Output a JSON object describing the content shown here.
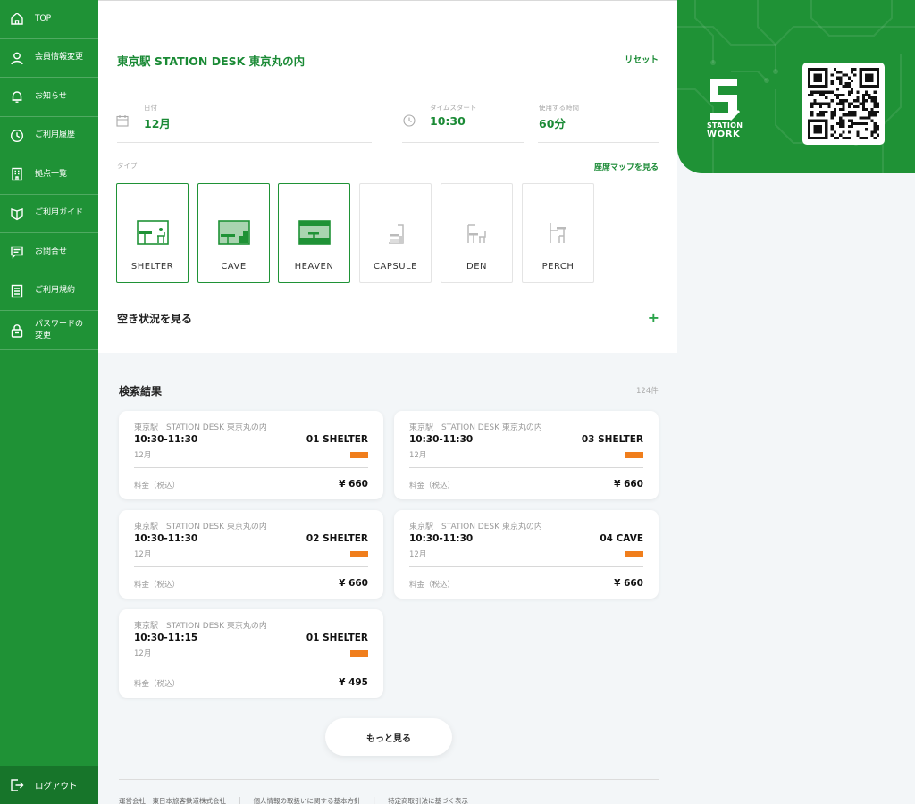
{
  "sidebar": {
    "items": [
      {
        "label": "TOP",
        "icon": "home-icon"
      },
      {
        "label": "会員情報変更",
        "icon": "user-icon"
      },
      {
        "label": "お知らせ",
        "icon": "bell-icon"
      },
      {
        "label": "ご利用履歴",
        "icon": "clock-icon"
      },
      {
        "label": "拠点一覧",
        "icon": "building-icon"
      },
      {
        "label": "ご利用ガイド",
        "icon": "shield-icon"
      },
      {
        "label": "お問合せ",
        "icon": "message-icon"
      },
      {
        "label": "ご利用規約",
        "icon": "document-icon"
      },
      {
        "label": "パスワードの\n変更",
        "icon": "lock-icon"
      }
    ],
    "logout_label": "ログアウト"
  },
  "search": {
    "location": "東京駅 STATION DESK 東京丸の内",
    "reset_label": "リセット",
    "date_label": "日付",
    "date_value": "12月",
    "time_label": "タイムスタート",
    "time_value": "10:30",
    "duration_label": "使用する時間",
    "duration_value": "60分",
    "type_label": "タイプ",
    "seat_map_label": "座席マップを見る",
    "types": [
      {
        "name": "SHELTER",
        "selected": true
      },
      {
        "name": "CAVE",
        "selected": true
      },
      {
        "name": "HEAVEN",
        "selected": true
      },
      {
        "name": "CAPSULE",
        "selected": false
      },
      {
        "name": "DEN",
        "selected": false
      },
      {
        "name": "PERCH",
        "selected": false
      }
    ],
    "availability_label": "空き状況を見る",
    "availability_toggle": "+"
  },
  "results": {
    "title": "検索結果",
    "count": "124件",
    "cards": [
      {
        "location": "東京駅　STATION DESK 東京丸の内",
        "time": "10:30-11:30",
        "seat": "01 SHELTER",
        "month": "12月",
        "price_label": "料金（税込）",
        "price": "¥ 660"
      },
      {
        "location": "東京駅　STATION DESK 東京丸の内",
        "time": "10:30-11:30",
        "seat": "03 SHELTER",
        "month": "12月",
        "price_label": "料金（税込）",
        "price": "¥ 660"
      },
      {
        "location": "東京駅　STATION DESK 東京丸の内",
        "time": "10:30-11:30",
        "seat": "02 SHELTER",
        "month": "12月",
        "price_label": "料金（税込）",
        "price": "¥ 660"
      },
      {
        "location": "東京駅　STATION DESK 東京丸の内",
        "time": "10:30-11:30",
        "seat": "04 CAVE",
        "month": "12月",
        "price_label": "料金（税込）",
        "price": "¥ 660"
      },
      {
        "location": "東京駅　STATION DESK 東京丸の内",
        "time": "10:30-11:15",
        "seat": "01 SHELTER",
        "month": "12月",
        "price_label": "料金（税込）",
        "price": "¥ 495"
      }
    ],
    "more_label": "もっと見る"
  },
  "footer": {
    "links": [
      "運営会社　東日本旅客鉄道株式会社",
      "個人情報の取扱いに関する基本方針",
      "特定商取引法に基づく表示"
    ]
  },
  "brand": {
    "logo_line1": "STATION",
    "logo_line2": "WORK",
    "green": "#1f9236",
    "accent_orange": "#f07e1c"
  }
}
